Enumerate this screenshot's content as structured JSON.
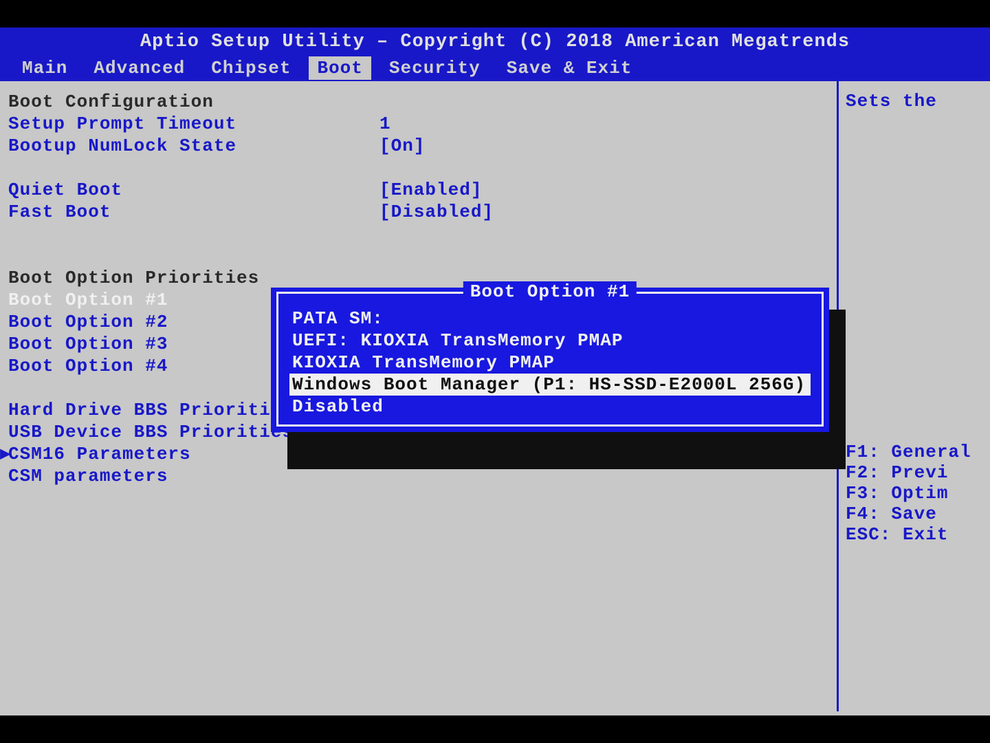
{
  "header": {
    "title": "Aptio Setup Utility – Copyright (C) 2018 American Megatrends",
    "tabs": [
      "Main",
      "Advanced",
      "Chipset",
      "Boot",
      "Security",
      "Save & Exit"
    ],
    "active_tab_index": 3
  },
  "main": {
    "section1_title": "Boot Configuration",
    "setup_prompt": {
      "label": "Setup Prompt Timeout",
      "value": "1"
    },
    "numlock": {
      "label": "Bootup NumLock State",
      "value": "[On]"
    },
    "quiet_boot": {
      "label": "Quiet Boot",
      "value": "[Enabled]"
    },
    "fast_boot": {
      "label": "Fast Boot",
      "value": "[Disabled]"
    },
    "section2_title": "Boot Option Priorities",
    "boot_opts": [
      {
        "label": "Boot Option #1"
      },
      {
        "label": "Boot Option #2"
      },
      {
        "label": "Boot Option #3"
      },
      {
        "label": "Boot Option #4"
      }
    ],
    "submenus": [
      "Hard Drive BBS Priorities",
      "USB Device BBS Priorities",
      "CSM16 Parameters",
      "CSM parameters"
    ]
  },
  "popup": {
    "title": "Boot Option #1",
    "items": [
      "PATA  SM:",
      "UEFI: KIOXIA TransMemory PMAP",
      "KIOXIA TransMemory PMAP",
      "Windows Boot Manager (P1: HS-SSD-E2000L 256G)",
      "Disabled"
    ],
    "selected_index": 3
  },
  "side": {
    "help_top": "Sets the",
    "keys": [
      "F1: General",
      "F2: Previ",
      "F3: Optim",
      "F4: Save",
      "ESC: Exit"
    ]
  }
}
